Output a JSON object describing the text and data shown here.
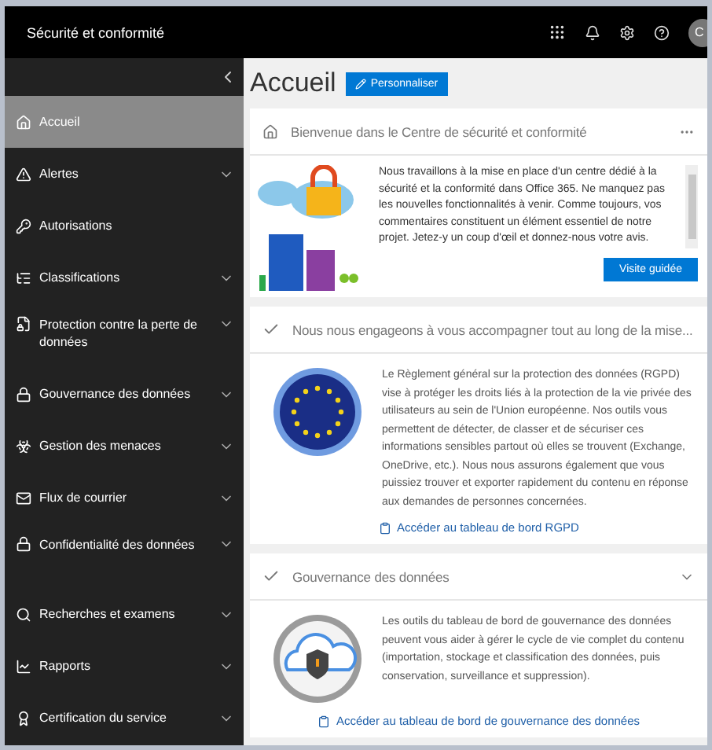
{
  "topbar": {
    "title": "Sécurité et conformité",
    "avatar": "C"
  },
  "sidebar": {
    "items": [
      {
        "kind": "home",
        "label": "Accueil",
        "selected": true,
        "expandable": false
      },
      {
        "kind": "alert",
        "label": "Alertes",
        "selected": false,
        "expandable": true
      },
      {
        "kind": "keys",
        "label": "Autorisations",
        "selected": false,
        "expandable": false
      },
      {
        "kind": "list",
        "label": "Classifications",
        "selected": false,
        "expandable": true
      },
      {
        "kind": "file-lock",
        "label": "Protection contre la perte de données",
        "selected": false,
        "expandable": true
      },
      {
        "kind": "lock",
        "label": "Gouvernance des données",
        "selected": false,
        "expandable": true
      },
      {
        "kind": "biohazard",
        "label": "Gestion des menaces",
        "selected": false,
        "expandable": true
      },
      {
        "kind": "mail",
        "label": "Flux de courrier",
        "selected": false,
        "expandable": true
      },
      {
        "kind": "lock",
        "label": "Confidentialité des données",
        "selected": false,
        "expandable": true
      },
      {
        "kind": "search",
        "label": "Recherches et examens",
        "selected": false,
        "expandable": true
      },
      {
        "kind": "chart",
        "label": "Rapports",
        "selected": false,
        "expandable": true
      },
      {
        "kind": "award",
        "label": "Certification du service",
        "selected": false,
        "expandable": true
      }
    ]
  },
  "page": {
    "title": "Accueil",
    "customize_button": "Personnaliser"
  },
  "cards": [
    {
      "kind": "welcome",
      "title": "Bienvenue dans le Centre de sécurité et conformité",
      "text": "Nous travaillons à la mise en place d'un centre dédié à la sécurité et la conformité dans Office 365. Ne manquez pas les nouvelles fonctionnalités à venir. Comme toujours, vos commentaires constituent un élément essentiel de notre projet. Jetez-y un coup d'œil et donnez-nous votre avis.",
      "button": "Visite guidée"
    },
    {
      "kind": "gdpr",
      "title": "Nous nous engageons à vous accompagner tout au long de la mise...",
      "text": "Le Règlement général sur la protection des données (RGPD) vise à protéger les droits liés à la protection de la vie privée des utilisateurs au sein de l'Union européenne. Nos outils vous permettent de détecter, de classer et de sécuriser ces informations sensibles partout où elles se trouvent (Exchange, OneDrive, etc.). Nous nous assurons également que vous puissiez trouver et exporter rapidement du contenu en réponse aux demandes de personnes concernées.",
      "link": "Accéder au tableau de bord RGPD"
    },
    {
      "kind": "governance",
      "title": "Gouvernance des données",
      "text": "Les outils du tableau de bord de gouvernance des données peuvent vous aider à gérer le cycle de vie complet du contenu (importation, stockage et classification des données, puis conservation, surveillance et suppression).",
      "link": "Accéder au tableau de bord de gouvernance des données"
    }
  ]
}
